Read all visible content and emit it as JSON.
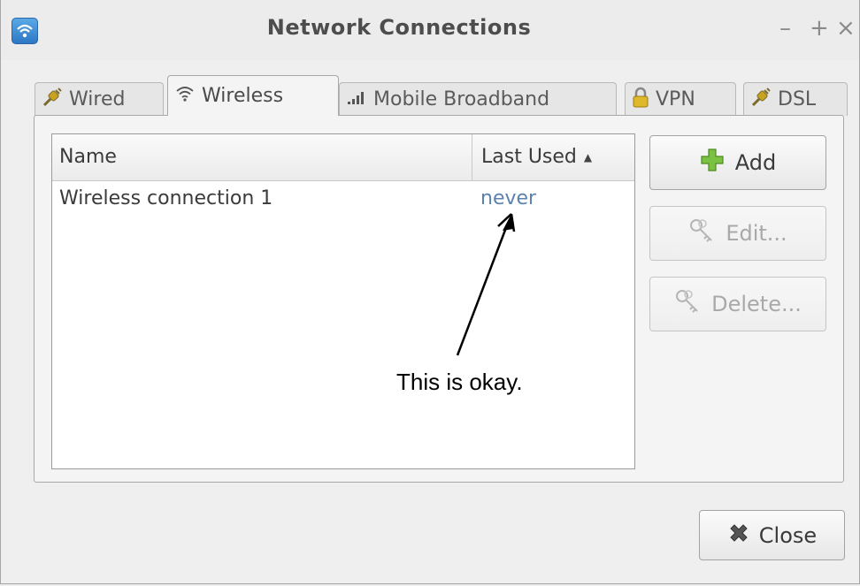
{
  "window": {
    "title": "Network Connections",
    "minimize": "–",
    "maximize": "+",
    "close": "×"
  },
  "tabs": [
    {
      "label": "Wired",
      "icon": "plug-icon",
      "active": false
    },
    {
      "label": "Wireless",
      "icon": "wifi-icon",
      "active": true
    },
    {
      "label": "Mobile Broadband",
      "icon": "signal-icon",
      "active": false
    },
    {
      "label": "VPN",
      "icon": "lock-icon",
      "active": false
    },
    {
      "label": "DSL",
      "icon": "plug-icon",
      "active": false
    }
  ],
  "list": {
    "columns": {
      "name": "Name",
      "last_used": "Last Used"
    },
    "sort_indicator": "▲",
    "rows": [
      {
        "name": "Wireless connection 1",
        "last_used": "never"
      }
    ]
  },
  "annotation": {
    "text": "This is okay."
  },
  "buttons": {
    "add": "Add",
    "edit": "Edit...",
    "delete": "Delete...",
    "close": "Close"
  },
  "colors": {
    "last_used_value": "#5b83ad",
    "add_icon": "#7cc242",
    "close_icon": "#555555"
  }
}
